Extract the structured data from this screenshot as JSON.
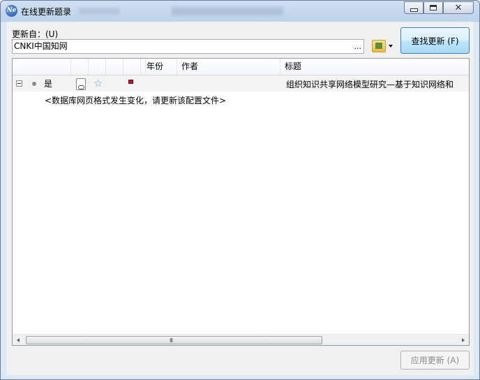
{
  "window": {
    "title": "在线更新题录",
    "app_icon": "Ne"
  },
  "source": {
    "label": "更新自：(U)",
    "value": "CNKI中国知网",
    "browse": "..."
  },
  "buttons": {
    "find": "查找更新 (F)",
    "apply": "应用更新 (A)"
  },
  "columns": [
    "",
    "",
    "",
    "",
    "",
    "",
    "年份",
    "作者",
    "标题"
  ],
  "rows": [
    {
      "status": "是",
      "year": "",
      "author": "",
      "title": "组织知识共享网络模型研究—基于知识网络和"
    }
  ],
  "message": "<数据库网页格式发生变化，请更新该配置文件>",
  "icons": {
    "expand": "collapse-minus-icon",
    "status": "gray-dot-icon",
    "attachment": "attachment-icon",
    "star": "star-icon",
    "flag": "red-flag-icon",
    "database": "database-icon"
  },
  "scroll_grip": "III"
}
